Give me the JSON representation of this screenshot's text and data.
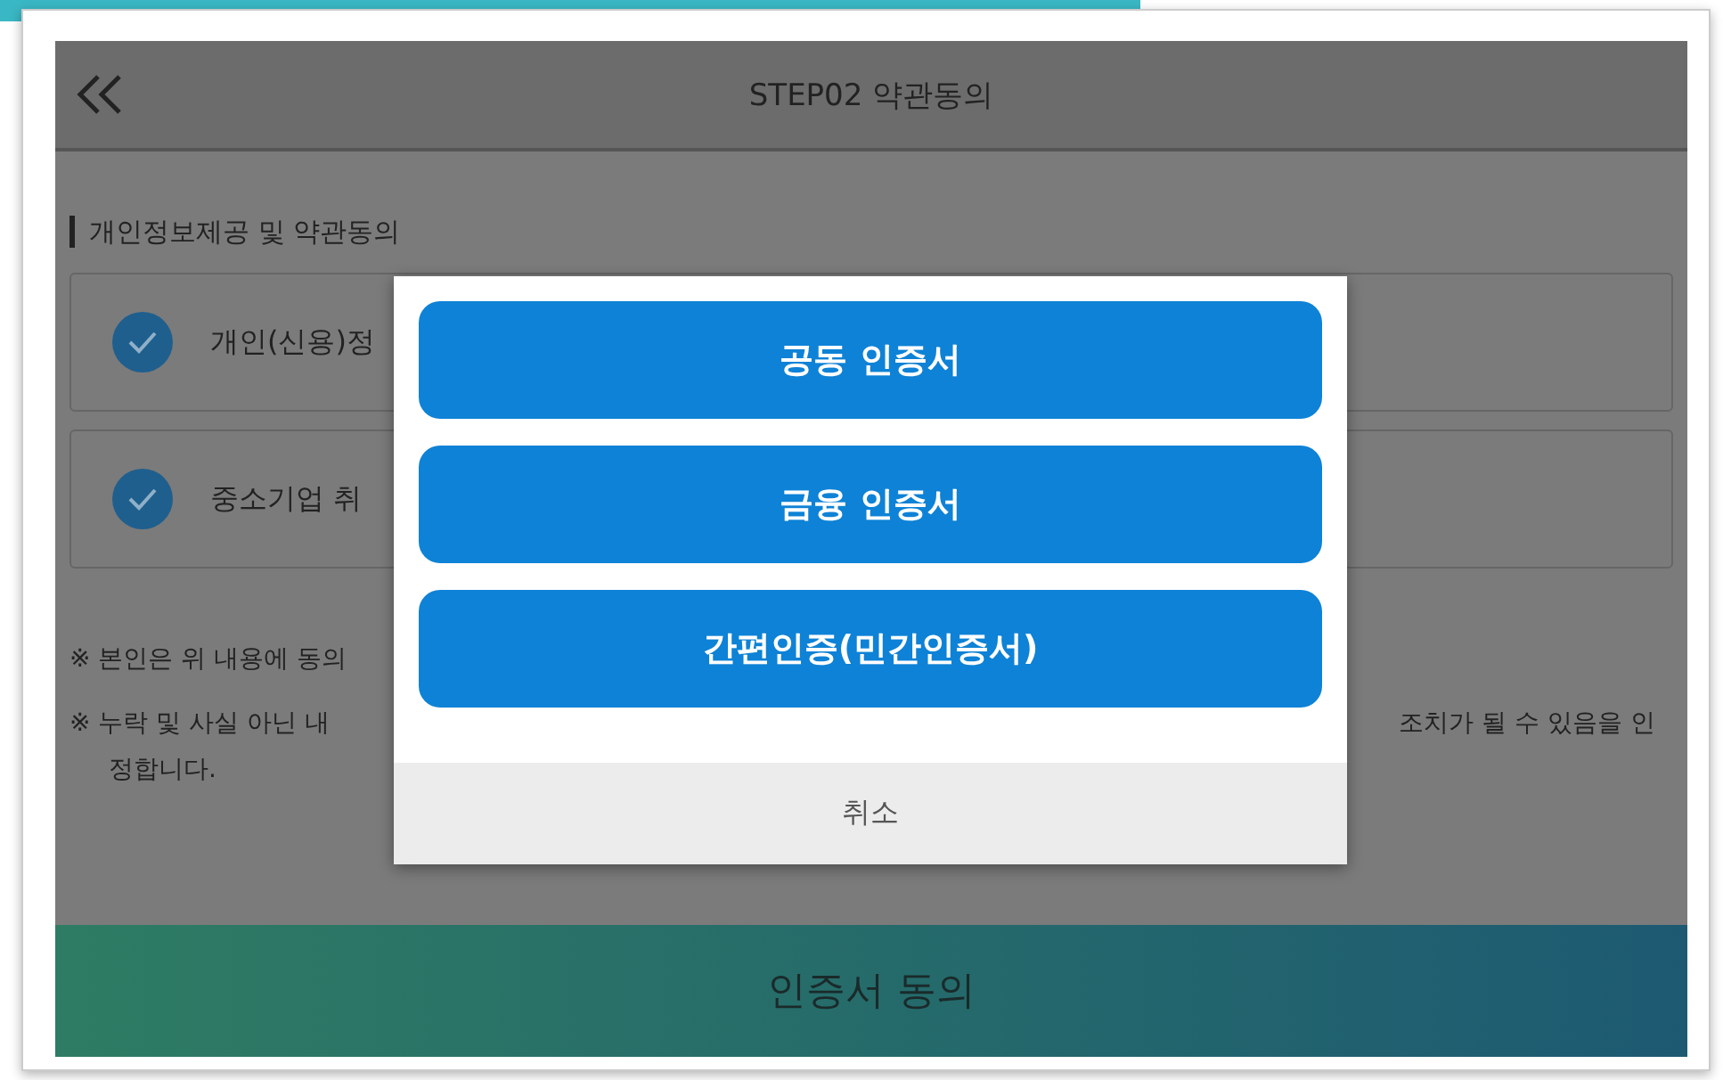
{
  "header": {
    "title": "STEP02 약관동의"
  },
  "section_title": "개인정보제공 및 약관동의",
  "agreements": [
    {
      "label": "개인(신용)정",
      "checked": true
    },
    {
      "label": "중소기업 취",
      "checked": true
    }
  ],
  "notes": [
    {
      "left": "※ 본인은 위 내용에 동의"
    },
    {
      "left": "※ 누락 및 사실 아닌 내",
      "right": "조치가 될 수 있음을 인",
      "continuation": "정합니다."
    }
  ],
  "submit_button": "인증서 동의",
  "modal": {
    "options": [
      "공동 인증서",
      "금융 인증서",
      "간편인증(민간인증서)"
    ],
    "cancel": "취소"
  }
}
